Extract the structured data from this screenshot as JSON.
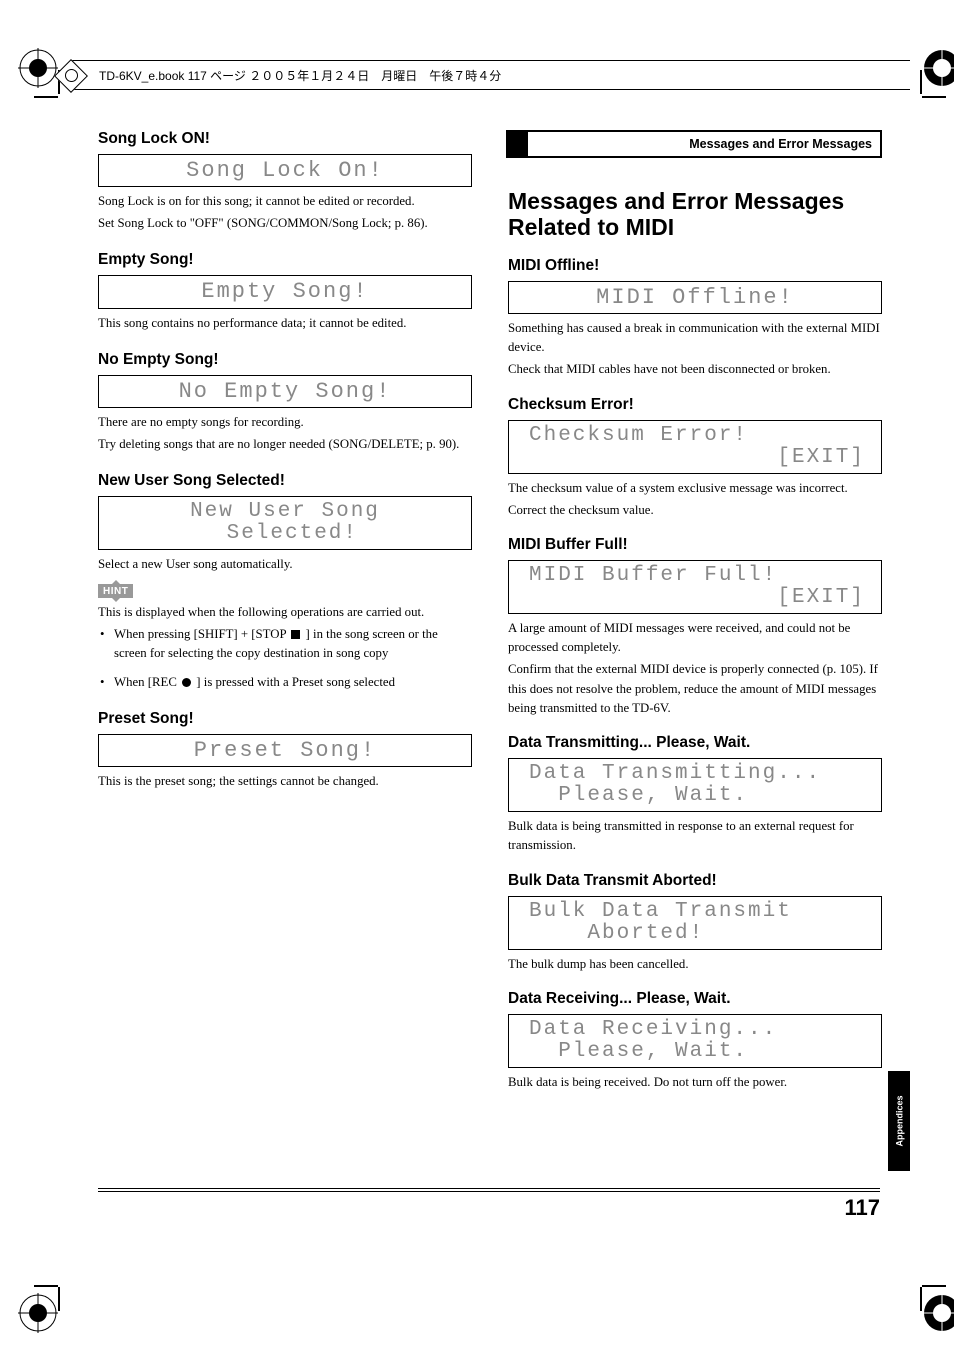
{
  "print_header": "TD-6KV_e.book  117 ページ  ２００５年１月２４日　月曜日　午後７時４分",
  "header_bar": "Messages and Error Messages",
  "side_tab": "Appendices",
  "page_number": "117",
  "left": {
    "s1": {
      "heading": "Song Lock ON!",
      "lcd": "Song Lock On!",
      "p1": "Song Lock is on for this song; it cannot be edited or recorded.",
      "p2": "Set Song Lock to \"OFF\" (SONG/COMMON/Song Lock; p. 86)."
    },
    "s2": {
      "heading": "Empty Song!",
      "lcd": "Empty Song!",
      "p1": "This song contains no performance data; it cannot be edited."
    },
    "s3": {
      "heading": "No Empty Song!",
      "lcd": "No Empty Song!",
      "p1": "There are no empty songs for recording.",
      "p2": "Try deleting songs that are no longer needed (SONG/DELETE; p. 90)."
    },
    "s4": {
      "heading": "New User Song Selected!",
      "lcd": "New User Song\n Selected!",
      "p1": "Select a new User song automatically.",
      "hint": "HINT",
      "p2": "This is displayed when the following operations are carried out.",
      "li1a": "When pressing [SHIFT] + [STOP ",
      "li1b": " ] in the song screen or the screen for selecting the copy destination in song copy",
      "li2a": "When [REC ",
      "li2b": " ] is pressed with a Preset song selected"
    },
    "s5": {
      "heading": "Preset Song!",
      "lcd": "Preset Song!",
      "p1": "This is the preset song; the settings cannot be changed."
    }
  },
  "right": {
    "title": "Messages and Error Messages Related to MIDI",
    "s1": {
      "heading": "MIDI Offline!",
      "lcd": "MIDI Offline!",
      "p1": "Something has caused a break in communication with the external MIDI device.",
      "p2": "Check that MIDI cables have not been disconnected or broken."
    },
    "s2": {
      "heading": "Checksum Error!",
      "lcd1": "Checksum Error!",
      "lcd2": "[EXIT]",
      "p1": "The checksum value of a system exclusive message was incorrect.",
      "p2": "Correct the checksum value."
    },
    "s3": {
      "heading": "MIDI Buffer Full!",
      "lcd1": "MIDI Buffer Full!",
      "lcd2": "[EXIT]",
      "p1": "A large amount of MIDI messages were received, and could not be processed completely.",
      "p2": "Confirm that the external MIDI device is properly connected (p. 105). If this does not resolve the problem, reduce the amount of MIDI messages being transmitted to the TD-6V."
    },
    "s4": {
      "heading": "Data Transmitting... Please, Wait.",
      "lcd": "Data Transmitting...\n  Please, Wait.",
      "p1": "Bulk data is being transmitted in response to an external request for transmission."
    },
    "s5": {
      "heading": "Bulk Data Transmit Aborted!",
      "lcd": "Bulk Data Transmit\n    Aborted!",
      "p1": "The bulk dump has been cancelled."
    },
    "s6": {
      "heading": "Data Receiving... Please, Wait.",
      "lcd": "Data Receiving...\n  Please, Wait.",
      "p1": "Bulk data is being received. Do not turn off the power."
    }
  }
}
